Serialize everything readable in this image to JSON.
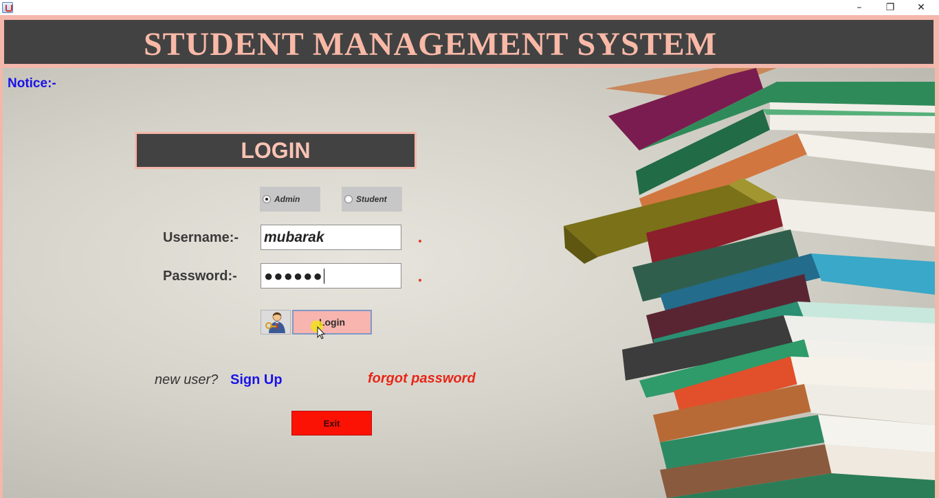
{
  "window": {
    "minimize_glyph": "–",
    "restore_glyph": "❐",
    "close_glyph": "✕"
  },
  "header": {
    "title": "STUDENT MANAGEMENT SYSTEM"
  },
  "notice": {
    "label": "Notice:-"
  },
  "login_panel": {
    "title": "LOGIN"
  },
  "role": {
    "options": [
      "Admin",
      "Student"
    ],
    "selected": "Admin"
  },
  "form": {
    "username_label": "Username:-",
    "username_value": "mubarak",
    "password_label": "Password:-",
    "password_masked": "●●●●●●"
  },
  "buttons": {
    "login_label": "Login",
    "exit_label": "Exit"
  },
  "links": {
    "new_user_text": "new user?",
    "signup_label": "Sign Up",
    "forgot_label": "forgot password"
  },
  "colors": {
    "header_bg": "#424242",
    "accent_salmon": "#f4b7ab",
    "link_blue": "#1a12e8",
    "link_red": "#e82518",
    "exit_red": "#fb1205"
  },
  "icons": {
    "app": "java-app-icon",
    "user": "user-with-key-icon",
    "cursor": "mouse-pointer-icon"
  }
}
